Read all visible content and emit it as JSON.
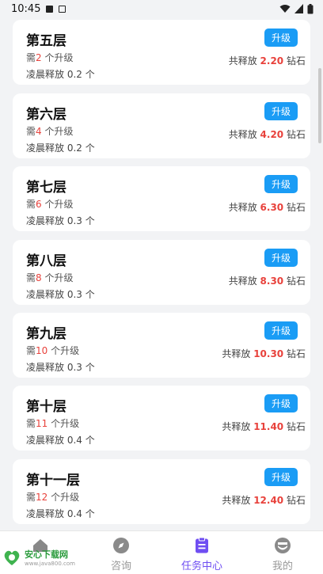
{
  "status_bar": {
    "time": "10:45",
    "partial_text": "凌晨释放 0.2 个"
  },
  "levels": [
    {
      "title": "第五层",
      "req_prefix": "需",
      "req_num": "2",
      "req_suffix": "个升级",
      "release": "凌晨释放 0.2 个",
      "button": "升级",
      "total_prefix": "共释放",
      "total_amt": "2.20",
      "total_suffix": "钻石"
    },
    {
      "title": "第六层",
      "req_prefix": "需",
      "req_num": "4",
      "req_suffix": "个升级",
      "release": "凌晨释放 0.2 个",
      "button": "升级",
      "total_prefix": "共释放",
      "total_amt": "4.20",
      "total_suffix": "钻石"
    },
    {
      "title": "第七层",
      "req_prefix": "需",
      "req_num": "6",
      "req_suffix": "个升级",
      "release": "凌晨释放 0.3 个",
      "button": "升级",
      "total_prefix": "共释放",
      "total_amt": "6.30",
      "total_suffix": "钻石"
    },
    {
      "title": "第八层",
      "req_prefix": "需",
      "req_num": "8",
      "req_suffix": "个升级",
      "release": "凌晨释放 0.3 个",
      "button": "升级",
      "total_prefix": "共释放",
      "total_amt": "8.30",
      "total_suffix": "钻石"
    },
    {
      "title": "第九层",
      "req_prefix": "需",
      "req_num": "10",
      "req_suffix": "个升级",
      "release": "凌晨释放 0.3 个",
      "button": "升级",
      "total_prefix": "共释放",
      "total_amt": "10.30",
      "total_suffix": "钻石"
    },
    {
      "title": "第十层",
      "req_prefix": "需",
      "req_num": "11",
      "req_suffix": "个升级",
      "release": "凌晨释放 0.4 个",
      "button": "升级",
      "total_prefix": "共释放",
      "total_amt": "11.40",
      "total_suffix": "钻石"
    },
    {
      "title": "第十一层",
      "req_prefix": "需",
      "req_num": "12",
      "req_suffix": "个升级",
      "release": "凌晨释放 0.4 个",
      "button": "升级",
      "total_prefix": "共释放",
      "total_amt": "12.40",
      "total_suffix": "钻石"
    }
  ],
  "tabbar": {
    "tabs": [
      {
        "label": "",
        "icon": "home-icon"
      },
      {
        "label": "咨询",
        "icon": "compass-icon"
      },
      {
        "label": "任务中心",
        "icon": "clipboard-icon",
        "active": true
      },
      {
        "label": "我的",
        "icon": "profile-icon"
      }
    ]
  },
  "watermark": {
    "title": "安心下载网",
    "url": "www.java800.com"
  },
  "colors": {
    "accent_blue": "#1a9cf5",
    "highlight_red": "#e8423c",
    "active_tab": "#6f4ef2"
  }
}
